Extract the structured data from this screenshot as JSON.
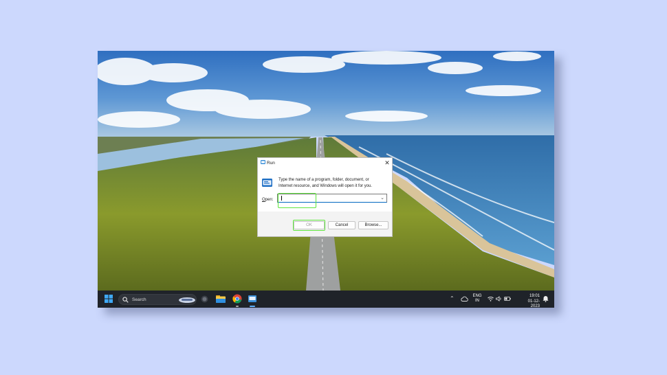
{
  "run_dialog": {
    "title": "Run",
    "description": "Type the name of a program, folder, document, or Internet resource, and Windows will open it for you.",
    "open_label_accel": "O",
    "open_label_rest": "pen:",
    "open_value": "",
    "ok_label": "OK",
    "cancel_label": "Cancel",
    "browse_label": "Browse...",
    "close_icon": "close-icon",
    "title_icon": "run-icon"
  },
  "taskbar": {
    "search_placeholder": "Search",
    "lang_line1": "ENG",
    "lang_line2": "IN",
    "time": "19:01",
    "date": "01-12-2023",
    "icons": [
      "windows-start-icon",
      "search-icon",
      "copilot-icon",
      "file-explorer-icon",
      "chrome-icon",
      "run-icon",
      "chevron-up-icon",
      "cloud-icon",
      "wifi-icon",
      "volume-icon",
      "battery-icon",
      "notification-icon"
    ]
  },
  "colors": {
    "page_background": "#ccd8fd",
    "taskbar": "#1f2329",
    "highlight": "#5ee63c",
    "accent": "#0067c0"
  }
}
